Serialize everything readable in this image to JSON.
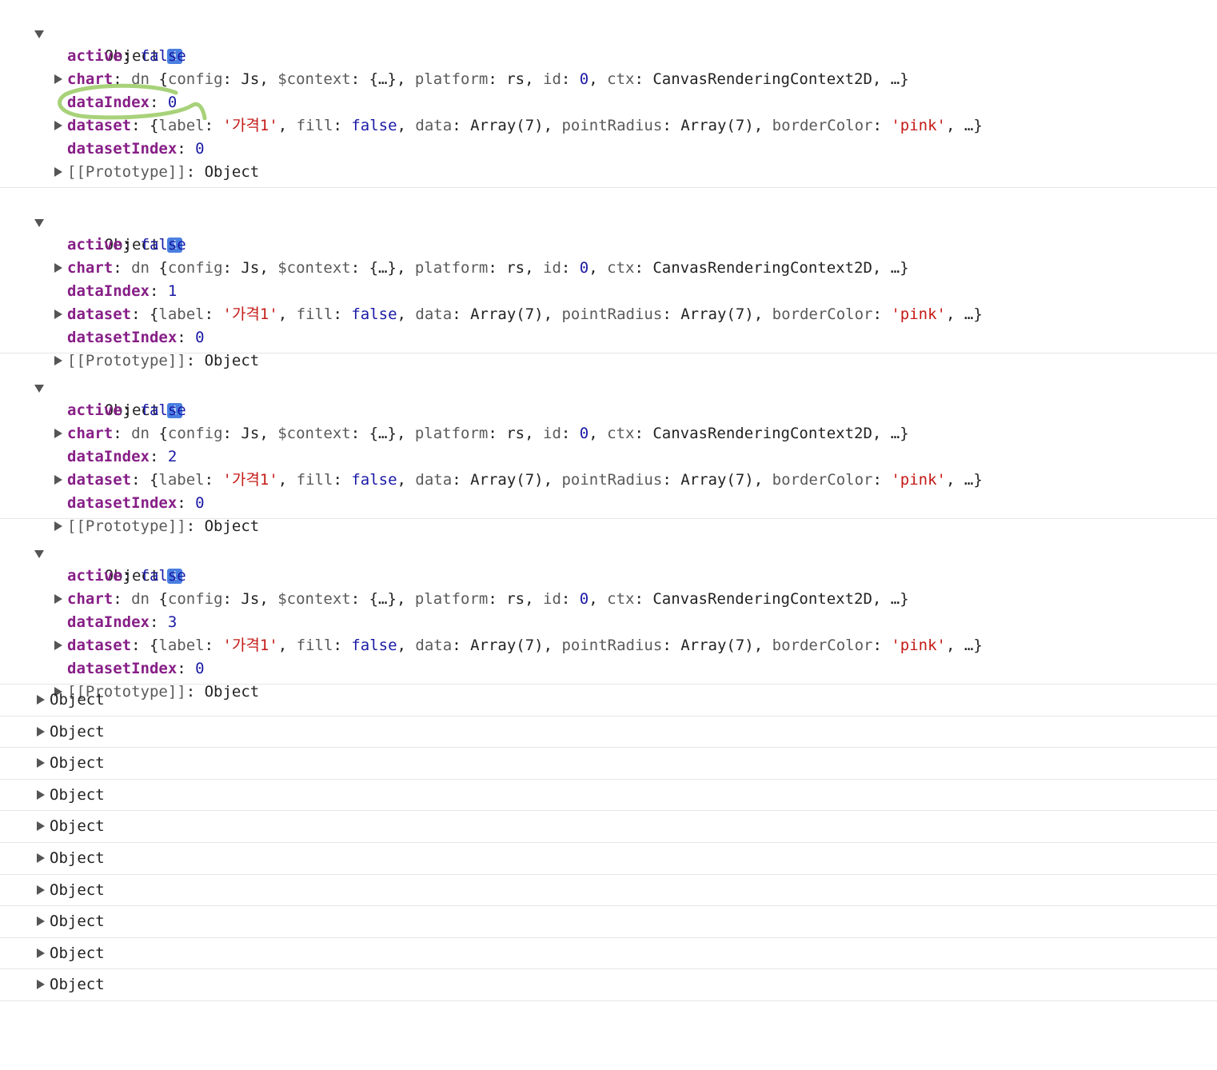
{
  "expanded_objects": [
    {
      "label": "Object",
      "info": "i",
      "active_key": "active",
      "active_value": "false",
      "chart_key": "chart",
      "chart_class": "dn",
      "chart_open": "{",
      "config_key": "config",
      "config_value": "Js",
      "context_key": "$context",
      "context_value": "{…}",
      "platform_key": "platform",
      "platform_value": "rs",
      "id_key": "id",
      "id_value": "0",
      "ctx_key": "ctx",
      "ctx_value": "CanvasRenderingContext2D",
      "chart_tail": "…}",
      "dataIndex_key": "dataIndex",
      "dataIndex_value": "0",
      "dataset_key": "dataset",
      "label_key": "label",
      "label_value": "'가격1'",
      "fill_key": "fill",
      "fill_value": "false",
      "data_key": "data",
      "data_value": "Array(7)",
      "pointRadius_key": "pointRadius",
      "pointRadius_value": "Array(7)",
      "borderColor_key": "borderColor",
      "borderColor_value": "'pink'",
      "dataset_tail": "…}",
      "datasetIndex_key": "datasetIndex",
      "datasetIndex_value": "0",
      "proto_key": "[[Prototype]]",
      "proto_value": "Object"
    },
    {
      "label": "Object",
      "info": "i",
      "active_key": "active",
      "active_value": "false",
      "chart_key": "chart",
      "chart_class": "dn",
      "chart_open": "{",
      "config_key": "config",
      "config_value": "Js",
      "context_key": "$context",
      "context_value": "{…}",
      "platform_key": "platform",
      "platform_value": "rs",
      "id_key": "id",
      "id_value": "0",
      "ctx_key": "ctx",
      "ctx_value": "CanvasRenderingContext2D",
      "chart_tail": "…}",
      "dataIndex_key": "dataIndex",
      "dataIndex_value": "1",
      "dataset_key": "dataset",
      "label_key": "label",
      "label_value": "'가격1'",
      "fill_key": "fill",
      "fill_value": "false",
      "data_key": "data",
      "data_value": "Array(7)",
      "pointRadius_key": "pointRadius",
      "pointRadius_value": "Array(7)",
      "borderColor_key": "borderColor",
      "borderColor_value": "'pink'",
      "dataset_tail": "…}",
      "datasetIndex_key": "datasetIndex",
      "datasetIndex_value": "0",
      "proto_key": "[[Prototype]]",
      "proto_value": "Object"
    },
    {
      "label": "Object",
      "info": "i",
      "active_key": "active",
      "active_value": "false",
      "chart_key": "chart",
      "chart_class": "dn",
      "chart_open": "{",
      "config_key": "config",
      "config_value": "Js",
      "context_key": "$context",
      "context_value": "{…}",
      "platform_key": "platform",
      "platform_value": "rs",
      "id_key": "id",
      "id_value": "0",
      "ctx_key": "ctx",
      "ctx_value": "CanvasRenderingContext2D",
      "chart_tail": "…}",
      "dataIndex_key": "dataIndex",
      "dataIndex_value": "2",
      "dataset_key": "dataset",
      "label_key": "label",
      "label_value": "'가격1'",
      "fill_key": "fill",
      "fill_value": "false",
      "data_key": "data",
      "data_value": "Array(7)",
      "pointRadius_key": "pointRadius",
      "pointRadius_value": "Array(7)",
      "borderColor_key": "borderColor",
      "borderColor_value": "'pink'",
      "dataset_tail": "…}",
      "datasetIndex_key": "datasetIndex",
      "datasetIndex_value": "0",
      "proto_key": "[[Prototype]]",
      "proto_value": "Object"
    },
    {
      "label": "Object",
      "info": "i",
      "active_key": "active",
      "active_value": "false",
      "chart_key": "chart",
      "chart_class": "dn",
      "chart_open": "{",
      "config_key": "config",
      "config_value": "Js",
      "context_key": "$context",
      "context_value": "{…}",
      "platform_key": "platform",
      "platform_value": "rs",
      "id_key": "id",
      "id_value": "0",
      "ctx_key": "ctx",
      "ctx_value": "CanvasRenderingContext2D",
      "chart_tail": "…}",
      "dataIndex_key": "dataIndex",
      "dataIndex_value": "3",
      "dataset_key": "dataset",
      "label_key": "label",
      "label_value": "'가격1'",
      "fill_key": "fill",
      "fill_value": "false",
      "data_key": "data",
      "data_value": "Array(7)",
      "pointRadius_key": "pointRadius",
      "pointRadius_value": "Array(7)",
      "borderColor_key": "borderColor",
      "borderColor_value": "'pink'",
      "dataset_tail": "…}",
      "datasetIndex_key": "datasetIndex",
      "datasetIndex_value": "0",
      "proto_key": "[[Prototype]]",
      "proto_value": "Object"
    }
  ],
  "collapsed_objects": [
    {
      "label": "Object"
    },
    {
      "label": "Object"
    },
    {
      "label": "Object"
    },
    {
      "label": "Object"
    },
    {
      "label": "Object"
    },
    {
      "label": "Object"
    },
    {
      "label": "Object"
    },
    {
      "label": "Object"
    },
    {
      "label": "Object"
    },
    {
      "label": "Object"
    }
  ],
  "colors": {
    "key": "#871f87",
    "keyword": "#1a1aa6",
    "string": "#c41a16",
    "info_badge": "#4a7fe0",
    "annotation": "#a8d27a"
  }
}
